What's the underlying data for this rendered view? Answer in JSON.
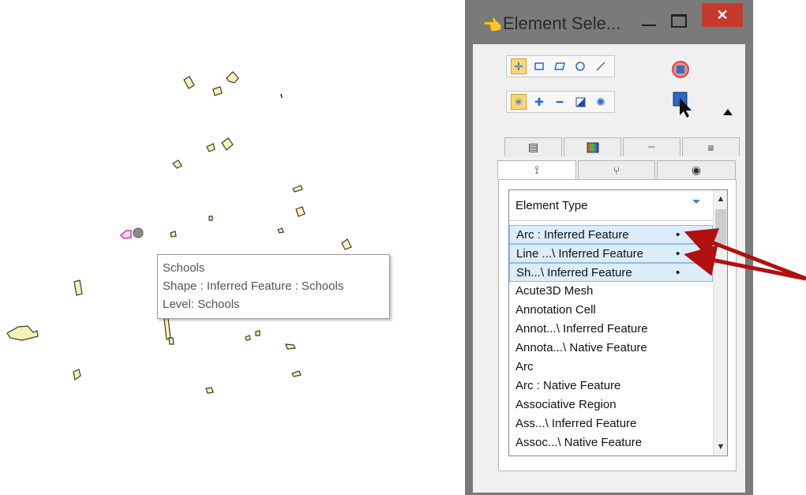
{
  "tooltip": {
    "title": "Schools",
    "type_line": "Shape : Inferred Feature : Schools",
    "level_line": "Level: Schools"
  },
  "window": {
    "title": "Element Sele...",
    "minimize_icon": "minimize-icon",
    "maximize_icon": "maximize-icon",
    "close_label": "✕"
  },
  "tools": {
    "method_group": [
      "element-icon",
      "block-icon",
      "shape-icon",
      "circle-icon",
      "line-icon"
    ],
    "mode_group": [
      "new-icon",
      "add-icon",
      "subtract-icon",
      "invert-icon",
      "clear-all-icon"
    ],
    "clear_selection_icon": "clear-selection-icon",
    "selection_cursor_icon": "selection-cursor-icon"
  },
  "tabs": {
    "row1": [
      "levels-icon",
      "color-icon",
      "line-style-icon",
      "weight-icon"
    ],
    "row2": [
      "type-icon",
      "class-icon",
      "view-icon"
    ]
  },
  "list": {
    "header": "Element Type",
    "items": [
      {
        "label": "Arc : Inferred Feature",
        "dot": "•",
        "selected": true
      },
      {
        "label": "Line ...\\ Inferred Feature",
        "dot": "•",
        "selected": true
      },
      {
        "label": "Sh...\\ Inferred Feature",
        "dot": "•",
        "selected": true
      },
      {
        "label": "Acute3D Mesh",
        "dot": "",
        "selected": false
      },
      {
        "label": "Annotation Cell",
        "dot": "",
        "selected": false
      },
      {
        "label": "Annot...\\ Inferred Feature",
        "dot": "",
        "selected": false
      },
      {
        "label": "Annota...\\ Native Feature",
        "dot": "",
        "selected": false
      },
      {
        "label": "Arc",
        "dot": "",
        "selected": false
      },
      {
        "label": "Arc : Native Feature",
        "dot": "",
        "selected": false
      },
      {
        "label": "Associative Region",
        "dot": "",
        "selected": false
      },
      {
        "label": "Ass...\\ Inferred Feature",
        "dot": "",
        "selected": false
      },
      {
        "label": "Assoc...\\ Native Feature",
        "dot": "",
        "selected": false
      }
    ]
  },
  "colors": {
    "parcel_fill": "#f8f1b4",
    "close_button": "#c7392b",
    "selected_row": "#dcecf8",
    "annotation_arrow": "#b01010"
  }
}
